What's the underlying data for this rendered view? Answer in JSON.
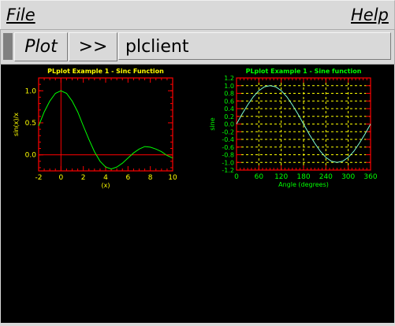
{
  "menubar": {
    "file": "File",
    "help": "Help"
  },
  "toolbar": {
    "plot_label": "Plot",
    "next_label": ">>",
    "client_label": "plclient"
  },
  "chart_data": [
    {
      "type": "line",
      "title": "PLplot Example 1 - Sinc Function",
      "xlabel": "(x)",
      "ylabel": "sin(x)/x",
      "xlim": [
        -2,
        10
      ],
      "ylim": [
        -0.25,
        1.2
      ],
      "xticks": [
        "-2",
        "0",
        "2",
        "4",
        "6",
        "8",
        "10"
      ],
      "yticks": [
        "0.0",
        "0.5",
        "1.0"
      ],
      "grid": "axes at x=0 and y=0",
      "series": [
        {
          "x": [
            -2,
            -1.5,
            -1,
            -0.5,
            0,
            0.5,
            1,
            1.5,
            2,
            2.5,
            3,
            3.5,
            4,
            4.5,
            5,
            5.5,
            6,
            6.5,
            7,
            7.5,
            8,
            8.5,
            9,
            9.5,
            10
          ],
          "y": [
            0.45,
            0.67,
            0.84,
            0.96,
            1.0,
            0.96,
            0.84,
            0.67,
            0.45,
            0.24,
            0.05,
            -0.1,
            -0.19,
            -0.22,
            -0.19,
            -0.13,
            -0.05,
            0.03,
            0.09,
            0.13,
            0.12,
            0.09,
            0.05,
            -0.01,
            -0.05
          ]
        }
      ],
      "colors": {
        "axes": "#ff0000",
        "title": "#ffff00",
        "labels": "#ffff00",
        "line": "#00ff00"
      }
    },
    {
      "type": "line",
      "title": "PLplot Example 1 - Sine function",
      "xlabel": "Angle (degrees)",
      "ylabel": "sine",
      "xlim": [
        0,
        360
      ],
      "ylim": [
        -1.2,
        1.2
      ],
      "xticks": [
        "0",
        "60",
        "120",
        "180",
        "240",
        "300",
        "360"
      ],
      "yticks": [
        "-1.2",
        "-1.0",
        "-0.8",
        "-0.6",
        "-0.4",
        "-0.2",
        "0.0",
        "0.2",
        "0.4",
        "0.6",
        "0.8",
        "1.0",
        "1.2"
      ],
      "grid": "on",
      "series": [
        {
          "x": [
            0,
            15,
            30,
            45,
            60,
            75,
            90,
            105,
            120,
            135,
            150,
            165,
            180,
            195,
            210,
            225,
            240,
            255,
            270,
            285,
            300,
            315,
            330,
            345,
            360
          ],
          "y": [
            0,
            0.26,
            0.5,
            0.71,
            0.87,
            0.97,
            1.0,
            0.97,
            0.87,
            0.71,
            0.5,
            0.26,
            0,
            -0.26,
            -0.5,
            -0.71,
            -0.87,
            -0.97,
            -1.0,
            -0.97,
            -0.87,
            -0.71,
            -0.5,
            -0.26,
            0
          ]
        }
      ],
      "colors": {
        "axes": "#ff0000",
        "grid": "#ffff00",
        "title": "#00ff00",
        "labels": "#00ff00",
        "line": "#7fffd4"
      }
    }
  ]
}
